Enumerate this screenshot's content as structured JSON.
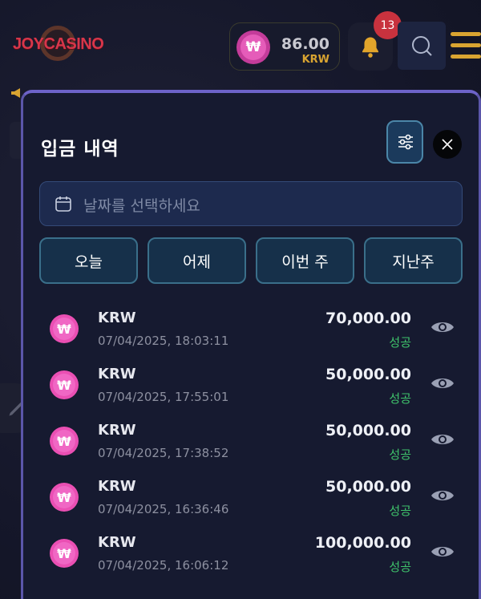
{
  "header": {
    "logo_text": "JOYCASINO",
    "balance": {
      "amount": "86.00",
      "currency": "KRW",
      "symbol": "₩"
    },
    "notifications_count": "13"
  },
  "panel": {
    "title": "입금 내역",
    "date_placeholder": "날짜를 선택하세요",
    "quick_filters": [
      "오늘",
      "어제",
      "이번 주",
      "지난주"
    ]
  },
  "transactions": [
    {
      "currency": "KRW",
      "datetime": "07/04/2025, 18:03:11",
      "amount": "70,000.00",
      "status": "성공"
    },
    {
      "currency": "KRW",
      "datetime": "07/04/2025, 17:55:01",
      "amount": "50,000.00",
      "status": "성공"
    },
    {
      "currency": "KRW",
      "datetime": "07/04/2025, 17:38:52",
      "amount": "50,000.00",
      "status": "성공"
    },
    {
      "currency": "KRW",
      "datetime": "07/04/2025, 16:36:46",
      "amount": "50,000.00",
      "status": "성공"
    },
    {
      "currency": "KRW",
      "datetime": "07/04/2025, 16:06:12",
      "amount": "100,000.00",
      "status": "성공"
    }
  ],
  "colors": {
    "accent": "#6d63c9",
    "success": "#3fc36b",
    "coin": "#ea4fb3",
    "gold": "#d9a431"
  }
}
